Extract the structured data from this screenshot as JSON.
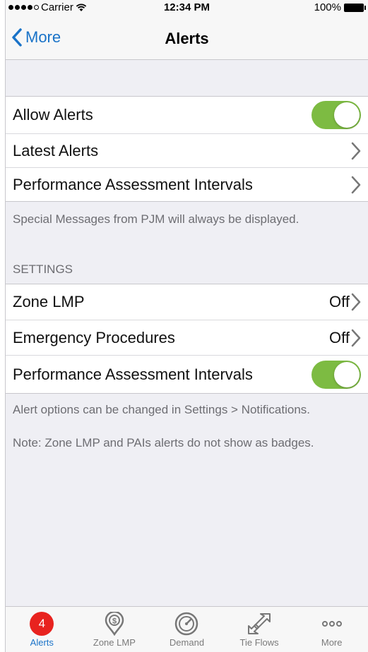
{
  "statusbar": {
    "carrier": "Carrier",
    "time": "12:34 PM",
    "battery": "100%"
  },
  "navbar": {
    "back_label": "More",
    "title": "Alerts"
  },
  "alerts_group": {
    "allow_alerts": {
      "label": "Allow Alerts",
      "toggle_on": true
    },
    "latest_alerts": {
      "label": "Latest Alerts"
    },
    "pai": {
      "label": "Performance Assessment Intervals"
    }
  },
  "alerts_footnote": "Special Messages from PJM will always be displayed.",
  "settings": {
    "header": "SETTINGS",
    "zone_lmp": {
      "label": "Zone LMP",
      "value": "Off"
    },
    "emergency": {
      "label": "Emergency Procedures",
      "value": "Off"
    },
    "pai": {
      "label": "Performance Assessment Intervals",
      "toggle_on": true
    }
  },
  "settings_footnote_1": "Alert options can be changed in Settings > Notifications.",
  "settings_footnote_2": "Note: Zone LMP and PAIs alerts do not show as badges.",
  "tabbar": {
    "tabs": [
      {
        "label": "Alerts",
        "badge": "4",
        "icon": "alerts-badge",
        "active": true
      },
      {
        "label": "Zone LMP",
        "icon": "dollar-pin-icon"
      },
      {
        "label": "Demand",
        "icon": "gauge-icon"
      },
      {
        "label": "Tie Flows",
        "icon": "arrows-icon"
      },
      {
        "label": "More",
        "icon": "more-dots-icon"
      }
    ]
  },
  "colors": {
    "accent": "#1a73c8",
    "toggle_on": "#7dbb42",
    "badge": "#e8231f",
    "background": "#efeff4"
  }
}
